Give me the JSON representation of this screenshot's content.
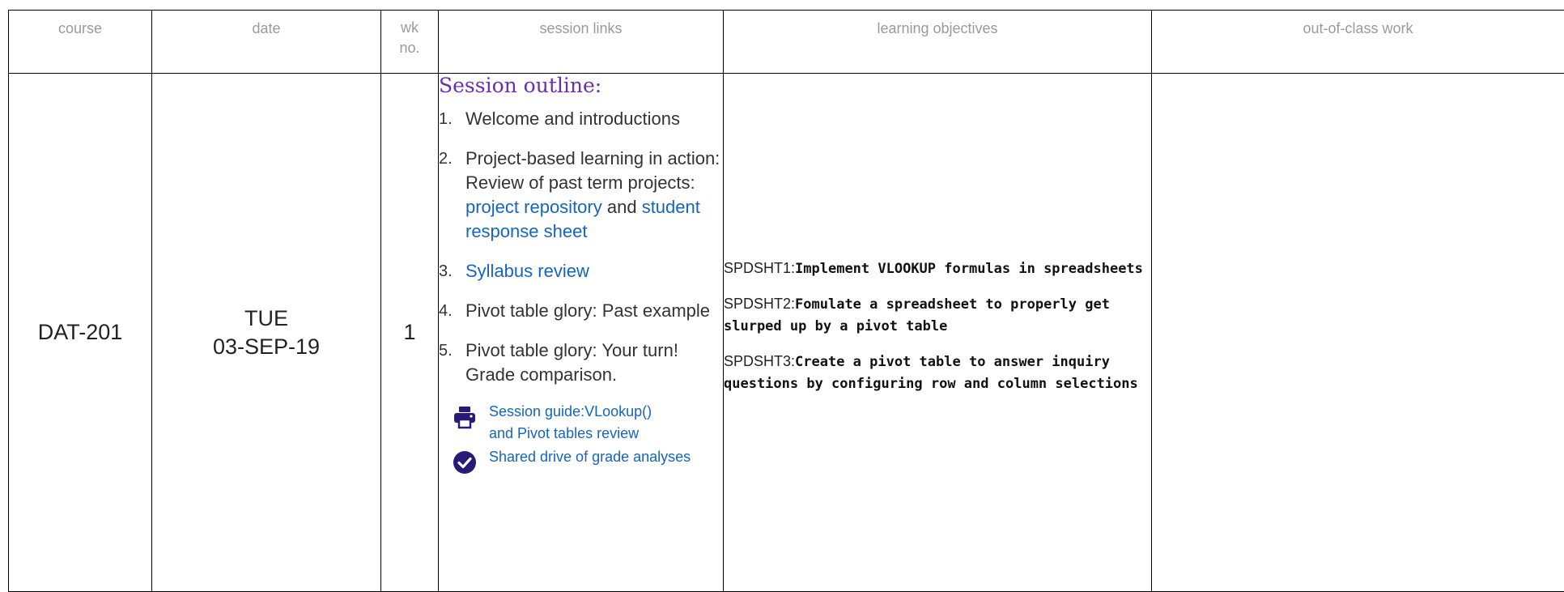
{
  "headers": {
    "course": "course",
    "date": "date",
    "wk_line1": "wk",
    "wk_line2": "no.",
    "session_links": "session links",
    "learning_objectives": "learning objectives",
    "out_of_class": "out-of-class work"
  },
  "row": {
    "course": "DAT-201",
    "day": "TUE",
    "date": "03-SEP-19",
    "week": "1",
    "outline_heading": "Session outline:",
    "items": [
      {
        "num": "1.",
        "text": "Welcome and introductions"
      },
      {
        "num": "2.",
        "text_a": "Project-based learning in action: Review of past term projects: ",
        "link1": "project repository",
        "text_b": " and ",
        "link2": "student response sheet"
      },
      {
        "num": "3.",
        "link": "Syllabus review"
      },
      {
        "num": "4.",
        "text": "Pivot table glory: Past example"
      },
      {
        "num": "5.",
        "text": "Pivot table glory: Your turn! Grade comparison."
      }
    ],
    "resources": [
      {
        "icon": "printer-icon",
        "line1": "Session guide:VLookup()",
        "line2": "and Pivot tables review"
      },
      {
        "icon": "check-circle-icon",
        "line1": "Shared drive of grade analyses"
      }
    ],
    "objectives": [
      {
        "code": "SPDSHT1:",
        "text": "Implement VLOOKUP formulas in spreadsheets"
      },
      {
        "code": "SPDSHT2:",
        "text": "Fomulate a spreadsheet to properly get slurped up by a pivot table"
      },
      {
        "code": "SPDSHT3:",
        "text": "Create a pivot table to answer inquiry questions by configuring row and column selections"
      }
    ],
    "out_of_class": ""
  },
  "colors": {
    "accent_purple": "#6a2fb0",
    "link_blue": "#1565c0",
    "header_gray": "#9a9a9a",
    "icon_navy": "#2a1a78"
  }
}
